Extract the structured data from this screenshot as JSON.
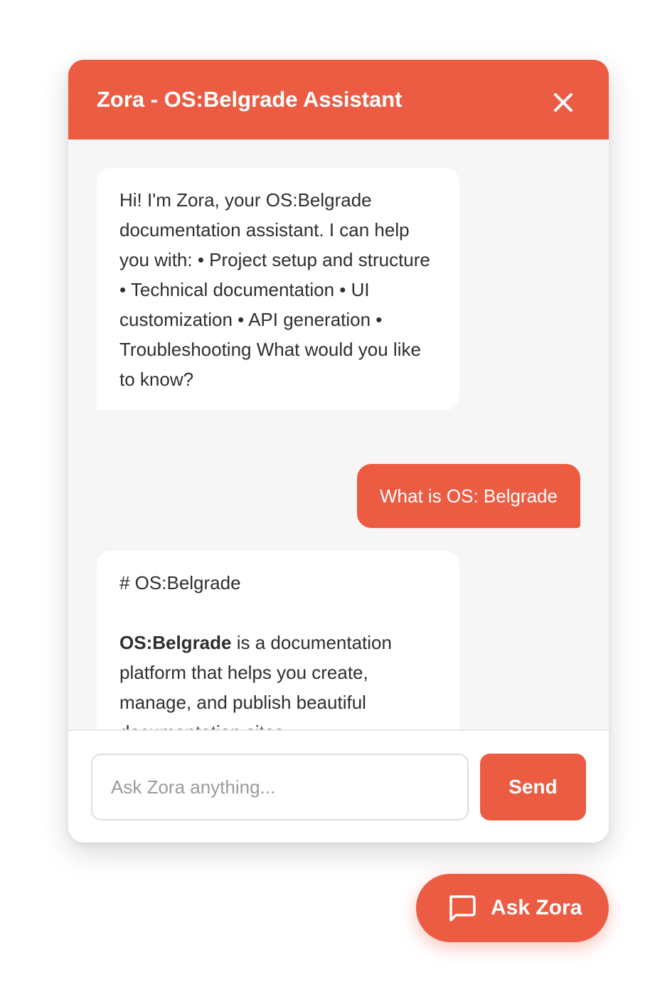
{
  "colors": {
    "accent": "#ec5c43",
    "message_area_bg": "#f6f6f6",
    "bot_bubble_bg": "#ffffff",
    "text": "#2e2e2e",
    "placeholder": "#9b9b9b"
  },
  "header": {
    "title": "Zora - OS:Belgrade Assistant",
    "close_icon": "close-icon"
  },
  "messages": [
    {
      "role": "assistant",
      "text": "Hi! I'm Zora, your OS:Belgrade documentation assistant. I can help you with: • Project setup and structure • Technical documentation • UI customization • API generation • Troubleshooting What would you like to know?"
    },
    {
      "role": "user",
      "text": "What is OS: Belgrade"
    },
    {
      "role": "assistant",
      "heading": "# OS:Belgrade",
      "strong": "OS:Belgrade",
      "text": " is a documentation platform that helps you create, manage, and publish beautiful documentation sites."
    }
  ],
  "input": {
    "placeholder": "Ask Zora anything...",
    "value": ""
  },
  "send_label": "Send",
  "fab": {
    "label": "Ask Zora",
    "icon": "chat-bubble-icon"
  }
}
